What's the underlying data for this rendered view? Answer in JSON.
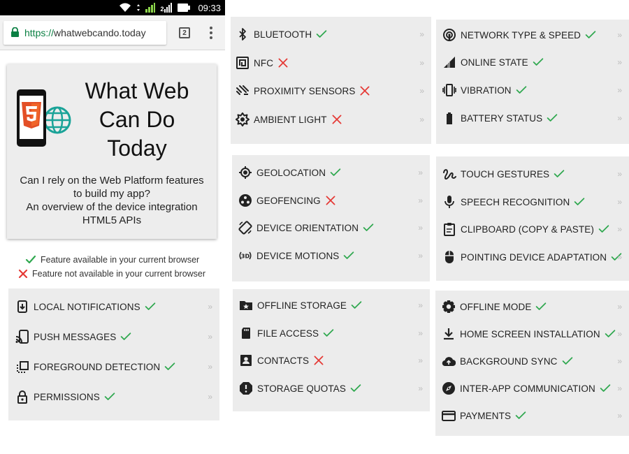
{
  "statusbar": {
    "time": "09:33",
    "sim_label": "2"
  },
  "browser": {
    "url_scheme": "https://",
    "url_host": "whatwebcando.today",
    "tab_count": "2"
  },
  "hero": {
    "title_lines": [
      "What Web",
      "Can Do",
      "Today"
    ],
    "desc_lines": [
      "Can I rely on the Web Platform features",
      "to build my app?",
      "An overview of the device integration",
      "HTML5 APIs"
    ]
  },
  "legend": {
    "available": "Feature available in your current browser",
    "unavailable": "Feature not available in your current browser"
  },
  "chevron": "»",
  "colors": {
    "available": "#2fa84f",
    "unavailable": "#e53935",
    "card_bg": "#ececec"
  },
  "cards": [
    {
      "id": "local",
      "items": [
        {
          "label": "LOCAL NOTIFICATIONS",
          "icon": "notification-icon",
          "available": true
        },
        {
          "label": "PUSH MESSAGES",
          "icon": "push-message-icon",
          "available": true
        },
        {
          "label": "FOREGROUND DETECTION",
          "icon": "foreground-icon",
          "available": true
        },
        {
          "label": "PERMISSIONS",
          "icon": "lock-icon",
          "available": true
        }
      ]
    },
    {
      "id": "sensors",
      "items": [
        {
          "label": "BLUETOOTH",
          "icon": "bluetooth-icon",
          "available": true
        },
        {
          "label": "NFC",
          "icon": "nfc-icon",
          "available": false
        },
        {
          "label": "PROXIMITY SENSORS",
          "icon": "proximity-icon",
          "available": false
        },
        {
          "label": "AMBIENT LIGHT",
          "icon": "light-icon",
          "available": false
        }
      ]
    },
    {
      "id": "location",
      "items": [
        {
          "label": "GEOLOCATION",
          "icon": "geolocation-icon",
          "available": true
        },
        {
          "label": "GEOFENCING",
          "icon": "geofencing-icon",
          "available": false
        },
        {
          "label": "DEVICE ORIENTATION",
          "icon": "orientation-icon",
          "available": true
        },
        {
          "label": "DEVICE MOTIONS",
          "icon": "motion-3d-icon",
          "available": true
        }
      ]
    },
    {
      "id": "storage",
      "items": [
        {
          "label": "OFFLINE STORAGE",
          "icon": "folder-star-icon",
          "available": true
        },
        {
          "label": "FILE ACCESS",
          "icon": "sd-card-icon",
          "available": true
        },
        {
          "label": "CONTACTS",
          "icon": "contact-icon",
          "available": false
        },
        {
          "label": "STORAGE QUOTAS",
          "icon": "alert-icon",
          "available": true
        }
      ]
    },
    {
      "id": "network",
      "items": [
        {
          "label": "NETWORK TYPE & SPEED",
          "icon": "network-icon",
          "available": true
        },
        {
          "label": "ONLINE STATE",
          "icon": "signal-icon",
          "available": true
        },
        {
          "label": "VIBRATION",
          "icon": "vibration-icon",
          "available": true
        },
        {
          "label": "BATTERY STATUS",
          "icon": "battery-icon",
          "available": true
        }
      ]
    },
    {
      "id": "input",
      "items": [
        {
          "label": "TOUCH GESTURES",
          "icon": "gesture-icon",
          "available": true
        },
        {
          "label": "SPEECH RECOGNITION",
          "icon": "mic-icon",
          "available": true
        },
        {
          "label": "CLIPBOARD (COPY & PASTE)",
          "icon": "clipboard-icon",
          "available": true
        },
        {
          "label": "POINTING DEVICE ADAPTATION",
          "icon": "mouse-icon",
          "available": true
        }
      ]
    },
    {
      "id": "os",
      "items": [
        {
          "label": "OFFLINE MODE",
          "icon": "settings-icon",
          "available": true
        },
        {
          "label": "HOME SCREEN INSTALLATION",
          "icon": "download-icon",
          "available": true
        },
        {
          "label": "BACKGROUND SYNC",
          "icon": "cloud-upload-icon",
          "available": true
        },
        {
          "label": "INTER-APP COMMUNICATION",
          "icon": "compass-icon",
          "available": true
        },
        {
          "label": "PAYMENTS",
          "icon": "credit-card-icon",
          "available": true
        }
      ]
    }
  ]
}
